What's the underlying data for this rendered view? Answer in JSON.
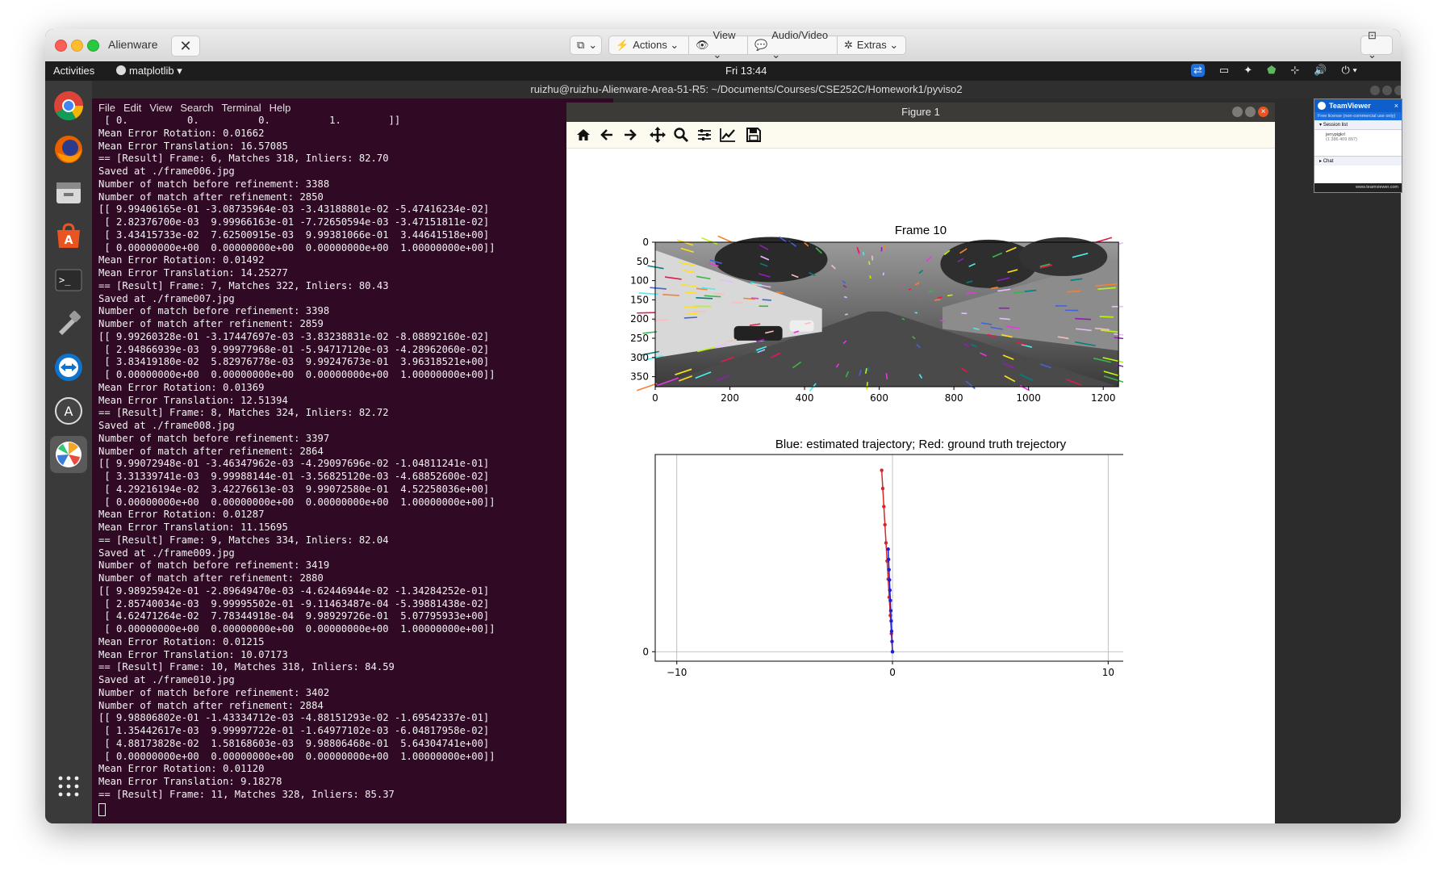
{
  "mac": {
    "window_title": "Alienware",
    "close_tab": "✕",
    "toolbar": [
      {
        "name": "clipboard-button",
        "icon": "⧉",
        "label": "⌄"
      },
      {
        "name": "actions-button",
        "icon": "⚡",
        "label": "Actions ⌄"
      },
      {
        "name": "view-button",
        "icon": "👁",
        "label": "View ⌄"
      },
      {
        "name": "audio-video-button",
        "icon": "💬",
        "label": "Audio/Video ⌄"
      },
      {
        "name": "extras-button",
        "icon": "✲",
        "label": "Extras ⌄"
      }
    ],
    "right_button": "⊡ ⌄"
  },
  "ubuntu": {
    "activities": "Activities",
    "app_menu": "matplotlib ▾",
    "clock": "Fri 13:44",
    "status_icons": [
      "⇄",
      "▭",
      "✦",
      "⬟",
      "⊹",
      "🔊",
      "⏻ ▾"
    ]
  },
  "terminal": {
    "window_title": "ruizhu@ruizhu-Alienware-Area-51-R5: ~/Documents/Courses/CSE252C/Homework1/pyviso2",
    "menu": [
      "File",
      "Edit",
      "View",
      "Search",
      "Terminal",
      "Help"
    ],
    "lines": [
      " [ 0.          0.          0.          1.        ]]",
      "Mean Error Rotation: 0.01662",
      "Mean Error Translation: 16.57085",
      "== [Result] Frame: 6, Matches 318, Inliers: 82.70",
      "Saved at ./frame006.jpg",
      "Number of match before refinement: 3388",
      "Number of match after refinement: 2850",
      "[[ 9.99406165e-01 -3.08735964e-03 -3.43188801e-02 -5.47416234e-02]",
      " [ 2.82376700e-03  9.99966163e-01 -7.72650594e-03 -3.47151811e-02]",
      " [ 3.43415733e-02  7.62500915e-03  9.99381066e-01  3.44641518e+00]",
      " [ 0.00000000e+00  0.00000000e+00  0.00000000e+00  1.00000000e+00]]",
      "Mean Error Rotation: 0.01492",
      "Mean Error Translation: 14.25277",
      "== [Result] Frame: 7, Matches 322, Inliers: 80.43",
      "Saved at ./frame007.jpg",
      "Number of match before refinement: 3398",
      "Number of match after refinement: 2859",
      "[[ 9.99260328e-01 -3.17447697e-03 -3.83238831e-02 -8.08892160e-02]",
      " [ 2.94866939e-03  9.99977968e-01 -5.94717120e-03 -4.28962060e-02]",
      " [ 3.83419180e-02  5.82976778e-03  9.99247673e-01  3.96318521e+00]",
      " [ 0.00000000e+00  0.00000000e+00  0.00000000e+00  1.00000000e+00]]",
      "Mean Error Rotation: 0.01369",
      "Mean Error Translation: 12.51394",
      "== [Result] Frame: 8, Matches 324, Inliers: 82.72",
      "Saved at ./frame008.jpg",
      "Number of match before refinement: 3397",
      "Number of match after refinement: 2864",
      "[[ 9.99072948e-01 -3.46347962e-03 -4.29097696e-02 -1.04811241e-01]",
      " [ 3.31339741e-03  9.99988144e-01 -3.56825120e-03 -4.68852600e-02]",
      " [ 4.29216194e-02  3.42276613e-03  9.99072580e-01  4.52258036e+00]",
      " [ 0.00000000e+00  0.00000000e+00  0.00000000e+00  1.00000000e+00]]",
      "Mean Error Rotation: 0.01287",
      "Mean Error Translation: 11.15695",
      "== [Result] Frame: 9, Matches 334, Inliers: 82.04",
      "Saved at ./frame009.jpg",
      "Number of match before refinement: 3419",
      "Number of match after refinement: 2880",
      "[[ 9.98925942e-01 -2.89649470e-03 -4.62446944e-02 -1.34284252e-01]",
      " [ 2.85740034e-03  9.99995502e-01 -9.11463487e-04 -5.39881438e-02]",
      " [ 4.62471264e-02  7.78344918e-04  9.98929726e-01  5.07795933e+00]",
      " [ 0.00000000e+00  0.00000000e+00  0.00000000e+00  1.00000000e+00]]",
      "Mean Error Rotation: 0.01215",
      "Mean Error Translation: 10.07173",
      "== [Result] Frame: 10, Matches 318, Inliers: 84.59",
      "Saved at ./frame010.jpg",
      "Number of match before refinement: 3402",
      "Number of match after refinement: 2884",
      "[[ 9.98806802e-01 -1.43334712e-03 -4.88151293e-02 -1.69542337e-01]",
      " [ 1.35442617e-03  9.99997722e-01 -1.64977102e-03 -6.04817958e-02]",
      " [ 4.88173828e-02  1.58168603e-03  9.98806468e-01  5.64304741e+00]",
      " [ 0.00000000e+00  0.00000000e+00  0.00000000e+00  1.00000000e+00]]",
      "Mean Error Rotation: 0.01120",
      "Mean Error Translation: 9.18278",
      "== [Result] Frame: 11, Matches 328, Inliers: 85.37"
    ]
  },
  "figure": {
    "window_title": "Figure 1",
    "toolbar_icons": [
      "home-icon",
      "back-arrow-icon",
      "forward-arrow-icon",
      "pan-icon",
      "zoom-icon",
      "configure-subplots-icon",
      "edit-axis-icon",
      "save-icon"
    ],
    "toolbar_glyphs": [
      "⌂",
      "←",
      "→",
      "✥",
      "🔍",
      "☰",
      "📈",
      "💾"
    ]
  },
  "chart_data": [
    {
      "type": "image",
      "title": "Frame 10",
      "xticks": [
        0,
        200,
        400,
        600,
        800,
        1000,
        1200
      ],
      "yticks": [
        0,
        50,
        100,
        150,
        200,
        250,
        300,
        350
      ],
      "xlim": [
        0,
        1241
      ],
      "ylim": [
        376,
        0
      ]
    },
    {
      "type": "line",
      "title": "Blue: estimated trajectory; Red: ground truth trejectory",
      "xticks": [
        -10,
        0,
        10
      ],
      "yticks": [
        0
      ],
      "xlim": [
        -11,
        11
      ],
      "ylim": [
        -0.6,
        12.5
      ],
      "grid": true,
      "series": [
        {
          "color": "#d62728",
          "x": [
            0,
            -0.05,
            -0.1,
            -0.15,
            -0.2,
            -0.25,
            -0.3,
            -0.35,
            -0.4,
            -0.45,
            -0.5
          ],
          "y": [
            0,
            1.15,
            2.3,
            3.45,
            4.6,
            5.75,
            6.9,
            8.05,
            9.2,
            10.35,
            11.5
          ]
        },
        {
          "color": "#1f1fd6",
          "x": [
            0,
            -0.02,
            -0.04,
            -0.06,
            -0.08,
            -0.1,
            -0.12,
            -0.14,
            -0.16,
            -0.18,
            -0.2
          ],
          "y": [
            0,
            0.65,
            1.3,
            1.95,
            2.6,
            3.25,
            3.9,
            4.55,
            5.2,
            5.85,
            6.5
          ]
        }
      ]
    }
  ],
  "teamviewer": {
    "title": "TeamViewer",
    "license": "Free license (non-commercial use only)",
    "session_list": "Session list",
    "user": "jerrypigkrl",
    "user_id": "(1 386 409 897)",
    "chat": "Chat",
    "link": "www.teamviewer.com"
  }
}
